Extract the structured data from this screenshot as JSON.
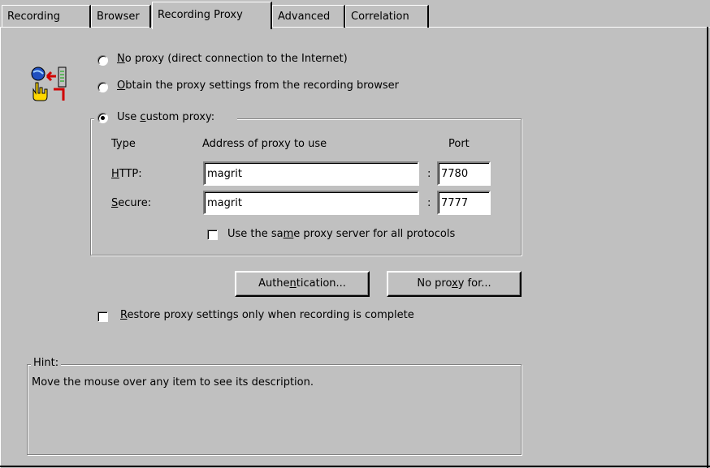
{
  "tabs": [
    {
      "label": "Recording",
      "active": false
    },
    {
      "label": "Browser",
      "active": false
    },
    {
      "label": "Recording Proxy",
      "active": true
    },
    {
      "label": "Advanced",
      "active": false
    },
    {
      "label": "Correlation",
      "active": false
    }
  ],
  "proxy_options": {
    "no_proxy": {
      "prefix": "",
      "accel": "N",
      "rest": "o proxy (direct connection to the Internet)",
      "selected": false
    },
    "obtain": {
      "prefix": "",
      "accel": "O",
      "rest": "btain the proxy settings from the recording browser",
      "selected": false
    },
    "custom": {
      "prefix": "Use ",
      "accel": "c",
      "rest": "ustom proxy:",
      "selected": true
    }
  },
  "custom_proxy": {
    "col_type": "Type",
    "col_address": "Address of proxy to use",
    "col_port": "Port",
    "http": {
      "label_accel": "H",
      "label_rest": "TTP:",
      "address": "magrit",
      "separator": ":",
      "port": "7780"
    },
    "secure": {
      "label_accel": "S",
      "label_rest": "ecure:",
      "address": "magrit",
      "separator": ":",
      "port": "7777"
    },
    "same_server": {
      "prefix": "Use the sa",
      "accel": "m",
      "rest": "e proxy server for all protocols",
      "checked": false
    }
  },
  "buttons": {
    "authentication": {
      "prefix": "Authe",
      "accel": "n",
      "rest": "tication..."
    },
    "no_proxy_for": {
      "prefix": "No pro",
      "accel": "x",
      "rest": "y for..."
    }
  },
  "restore": {
    "prefix": "",
    "accel": "R",
    "rest": "estore proxy settings only when recording is complete",
    "checked": false
  },
  "hint": {
    "title": "Hint:",
    "text": "Move the mouse over any item to see its description."
  },
  "icons": {
    "proxy": "proxy-settings-icon"
  }
}
